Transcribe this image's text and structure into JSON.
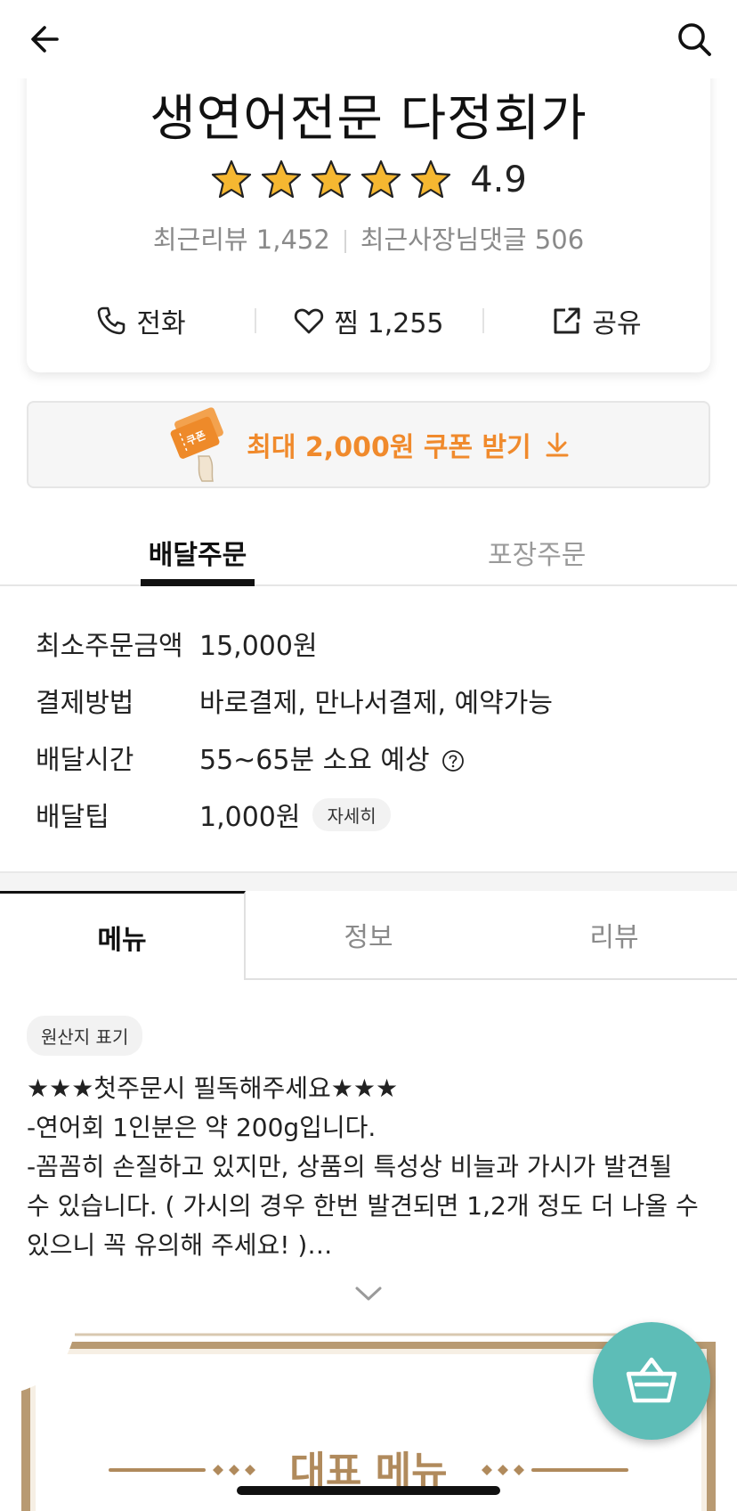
{
  "header": {
    "back_icon": "arrow-left-icon",
    "search_icon": "search-icon"
  },
  "store": {
    "name": "생연어전문 다정회가",
    "rating": "4.9",
    "stars": 5,
    "star_color": "#f5b731",
    "recent_reviews": "최근리뷰 1,452",
    "recent_owner_replies": "최근사장님댓글 506",
    "actions": {
      "call_label": "전화",
      "wish_label": "찜 1,255",
      "share_label": "공유"
    }
  },
  "coupon": {
    "label": "최대 2,000원 쿠폰 받기",
    "ticket_text": "쿠폰",
    "accent_color": "#f08a2c"
  },
  "order_tabs": {
    "delivery": "배달주문",
    "pickup": "포장주문"
  },
  "info": {
    "min_order": {
      "label": "최소주문금액",
      "value": "15,000원"
    },
    "payment": {
      "label": "결제방법",
      "value": "바로결제, 만나서결제, 예약가능"
    },
    "delivery_time": {
      "label": "배달시간",
      "value": "55~65분 소요 예상"
    },
    "delivery_tip": {
      "label": "배달팁",
      "value": "1,000원",
      "detail_button": "자세히"
    }
  },
  "main_tabs": {
    "menu": "메뉴",
    "info": "정보",
    "reviews": "리뷰"
  },
  "origin_label": "원산지 표기",
  "notice_lines": [
    "★★★첫주문시 필독해주세요★★★",
    "-연어회 1인분은 약 200g입니다.",
    "-꼼꼼히 손질하고 있지만, 상품의 특성상 비늘과 가시가 발견될",
    "수 있습니다. ( 가시의 경우 한번 발견되면 1,2개 정도 더 나올 수",
    "있으니 꼭 유의해 주세요! )…"
  ],
  "banner": {
    "title": "대표 메뉴",
    "title_color": "#b08a5c"
  },
  "cart": {
    "icon": "basket-icon",
    "color": "#5dbdb7"
  }
}
